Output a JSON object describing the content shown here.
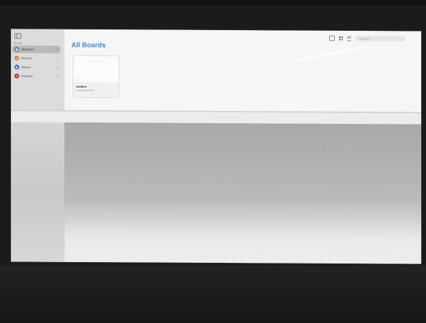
{
  "sidebar": {
    "header": "Boards",
    "items": [
      {
        "label": "All Boards",
        "count": "1",
        "icon": "all-boards-icon",
        "color": "#4a86c8",
        "glyph": "◼",
        "selected": true
      },
      {
        "label": "Recents",
        "count": "1",
        "icon": "clock-icon",
        "color": "#d9822b",
        "glyph": "◷",
        "selected": false
      },
      {
        "label": "Shared",
        "count": "0",
        "icon": "people-icon",
        "color": "#3a6fc4",
        "glyph": "◉",
        "selected": false
      },
      {
        "label": "Favorites",
        "count": "0",
        "icon": "heart-icon",
        "color": "#c8323a",
        "glyph": "♥",
        "selected": false
      }
    ]
  },
  "main": {
    "title": "All Boards",
    "search_placeholder": "Search",
    "boards": [
      {
        "title": "Untitled",
        "subtitle": "Yesterday, 3:56 PM",
        "thumb_text": "1/1"
      }
    ]
  }
}
